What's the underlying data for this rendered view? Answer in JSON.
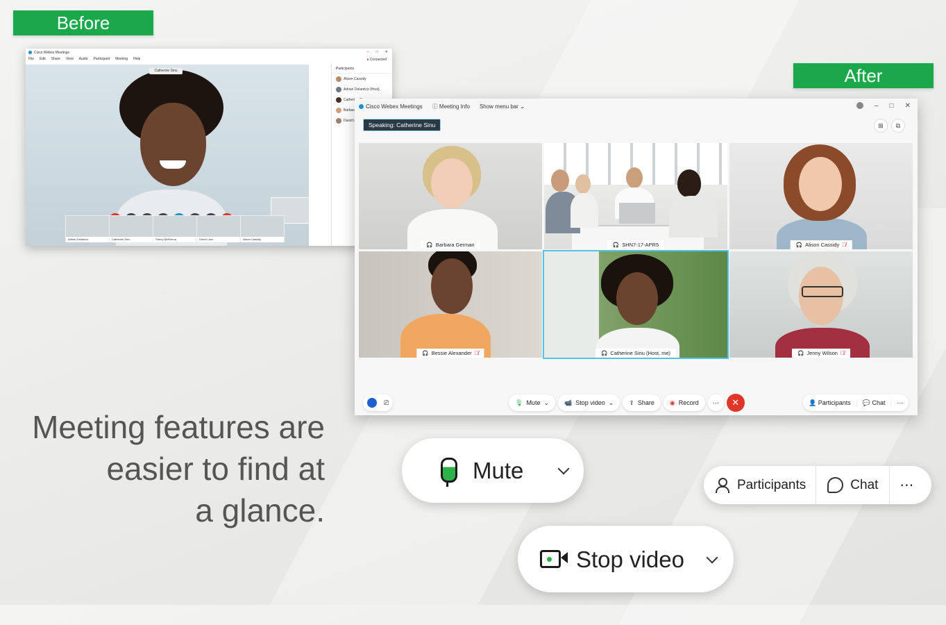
{
  "labels": {
    "before": "Before",
    "after": "After"
  },
  "headline": [
    "Meeting features are",
    "easier to find at",
    "a glance."
  ],
  "before_window": {
    "app_title": "Cisco Webex Meetings",
    "menu": [
      "File",
      "Edit",
      "Share",
      "View",
      "Audio",
      "Participant",
      "Meeting",
      "Help"
    ],
    "status": "Connected",
    "speaker_label": "Catherine Sinu",
    "participants_header": "Participants",
    "participants": [
      "Alison Cassidy",
      "Adrian Delamico (Host)",
      "Catherine Sinu",
      "Barbara German (h",
      "David Liam"
    ],
    "thumbnails": [
      "Adrian Delamico",
      "Catherine Sinu",
      "Sherry McKenna",
      "David Liam",
      "Alison Cassidy"
    ]
  },
  "after_window": {
    "app_title": "Cisco Webex Meetings",
    "meeting_info": "Meeting Info",
    "show_menu_bar": "Show menu bar",
    "speaking": "Speaking: Catherine Sinu",
    "tiles": [
      {
        "name": "Barbara German",
        "muted": false
      },
      {
        "name": "SHN7-17-APR5",
        "muted": false
      },
      {
        "name": "Alison Cassidy",
        "muted": true
      },
      {
        "name": "Bessie Alexander",
        "muted": true
      },
      {
        "name": "Catherine Sinu (Host, me)",
        "muted": false
      },
      {
        "name": "Jenny Wilson",
        "muted": true
      }
    ],
    "controls": {
      "mute": "Mute",
      "stop_video": "Stop video",
      "share": "Share",
      "record": "Record",
      "participants": "Participants",
      "chat": "Chat",
      "more": "⋯"
    }
  },
  "zoom": {
    "mute": "Mute",
    "stop_video": "Stop video",
    "participants": "Participants",
    "chat": "Chat",
    "more": "⋯"
  },
  "colors": {
    "tag_green": "#1aa84a",
    "end_red": "#e0362a",
    "mic_green": "#2bb34a",
    "active_border": "#4fc3e8"
  }
}
